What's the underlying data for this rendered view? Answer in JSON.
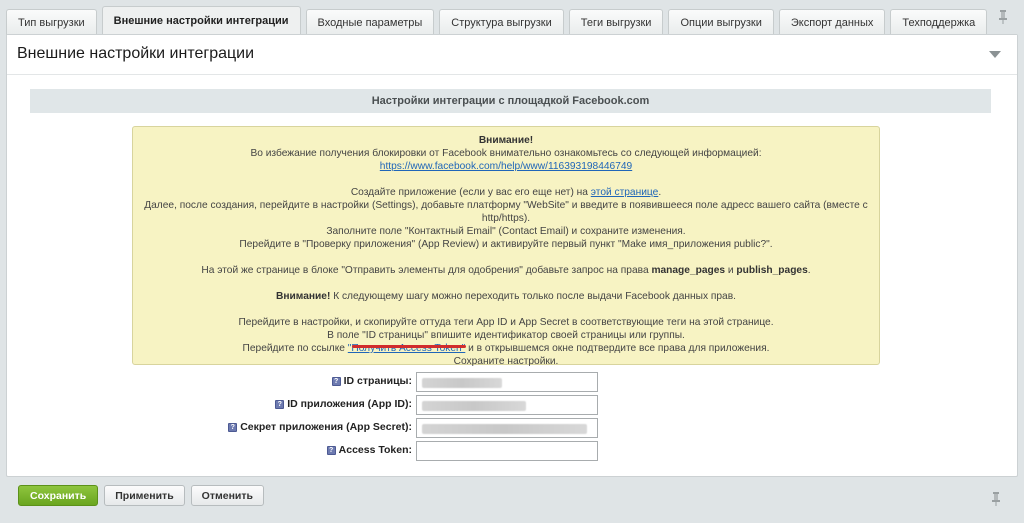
{
  "tabs": [
    {
      "label": "Тип выгрузки"
    },
    {
      "label": "Внешние настройки интеграции"
    },
    {
      "label": "Входные параметры"
    },
    {
      "label": "Структура выгрузки"
    },
    {
      "label": "Теги выгрузки"
    },
    {
      "label": "Опции выгрузки"
    },
    {
      "label": "Экспорт данных"
    },
    {
      "label": "Техподдержка"
    }
  ],
  "panel": {
    "title": "Внешние настройки интеграции",
    "section_title": "Настройки интеграции с площадкой Facebook.com"
  },
  "notice": {
    "attention": "Внимание!",
    "line1": "Во избежание получения блокировки от Facebook внимательно ознакомьтесь со следующей информацией:",
    "link1": "https://www.facebook.com/help/www/116393198446749",
    "line2_pre": "Создайте приложение (если у вас его еще нет) на ",
    "line2_link": "этой странице",
    "line2_post": ".",
    "line3": "Далее, после создания, перейдите в настройки (Settings), добавьте платформу \"WebSite\" и введите в появившееся поле адресс вашего сайта (вместе с http/https).",
    "line4": "Заполните поле \"Контактный Email\" (Contact Email) и сохраните изменения.",
    "line5": "Перейдите в \"Проверку приложения\" (App Review) и активируйте первый пункт \"Make имя_приложения public?\".",
    "line6_pre": "На этой же странице в блоке \"Отправить элементы для одобрения\" добавьте запрос на права ",
    "line6_b1": "manage_pages",
    "line6_mid": " и ",
    "line6_b2": "publish_pages",
    "line6_post": ".",
    "line7_b": "Внимание!",
    "line7": " К следующему шагу можно переходить только после выдачи Facebook данных прав.",
    "line8": "Перейдите в настройки, и скопируйте оттуда теги App ID и App Secret в соответствующие теги на этой странице.",
    "line9": "В поле \"ID страницы\" впишите идентификатор своей страницы или группы.",
    "line10_pre": "Перейдите по ссылке ",
    "line10_link": "\"Получить Access Token\"",
    "line10_post": " и в открывшемся окне подтвердите все права для приложения.",
    "line11": "Сохраните настройки."
  },
  "form": {
    "page_id_label": "ID страницы:",
    "app_id_label": "ID приложения (App ID):",
    "app_secret_label": "Секрет приложения (App Secret):",
    "access_token_label": "Access Token:",
    "help_glyph": "?"
  },
  "buttons": {
    "save": "Сохранить",
    "apply": "Применить",
    "cancel": "Отменить"
  },
  "colors": {
    "save_button": "#7ab42c",
    "notice_bg": "#f7f3c3",
    "link": "#2066b8",
    "highlight": "#d12c2c"
  }
}
